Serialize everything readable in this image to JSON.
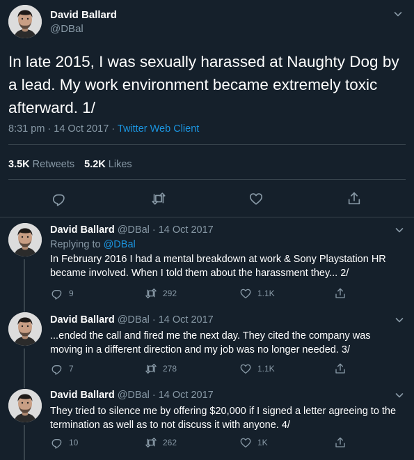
{
  "main_tweet": {
    "author_name": "David Ballard",
    "author_handle": "@DBal",
    "text": "In late 2015, I was sexually harassed at Naughty Dog by a lead. My work environment became extremely toxic afterward. 1/",
    "time": "8:31 pm · 14 Oct 2017 · ",
    "client": "Twitter Web Client",
    "retweets_count": "3.5K",
    "retweets_label": " Retweets",
    "likes_count": "5.2K",
    "likes_label": " Likes"
  },
  "replies": [
    {
      "author_name": "David Ballard",
      "author_meta": " @DBal · 14 Oct 2017",
      "replying_label": "Replying to ",
      "replying_handle": "@DBal",
      "text": "In February 2016 I had a mental breakdown at work & Sony Playstation HR became involved. When I told them about the harassment they... 2/",
      "reply_count": "9",
      "retweet_count": "292",
      "like_count": "1.1K"
    },
    {
      "author_name": "David Ballard",
      "author_meta": " @DBal · 14 Oct 2017",
      "text": "...ended the call and fired me the next day. They cited the company was moving in a different direction and my job was no longer needed. 3/",
      "reply_count": "7",
      "retweet_count": "278",
      "like_count": "1.1K"
    },
    {
      "author_name": "David Ballard",
      "author_meta": " @DBal · 14 Oct 2017",
      "text": "They tried to silence me by offering $20,000 if I signed a letter agreeing to the termination as well as to not discuss it with anyone. 4/",
      "reply_count": "10",
      "retweet_count": "262",
      "like_count": "1K"
    }
  ],
  "icons": {
    "reply": "reply-icon",
    "retweet": "retweet-icon",
    "like": "heart-icon",
    "share": "share-icon",
    "menu": "chevron-down-icon"
  },
  "colors": {
    "background": "#15202b",
    "muted": "#8899a6",
    "link": "#1b95e0",
    "divider": "#38444d"
  }
}
